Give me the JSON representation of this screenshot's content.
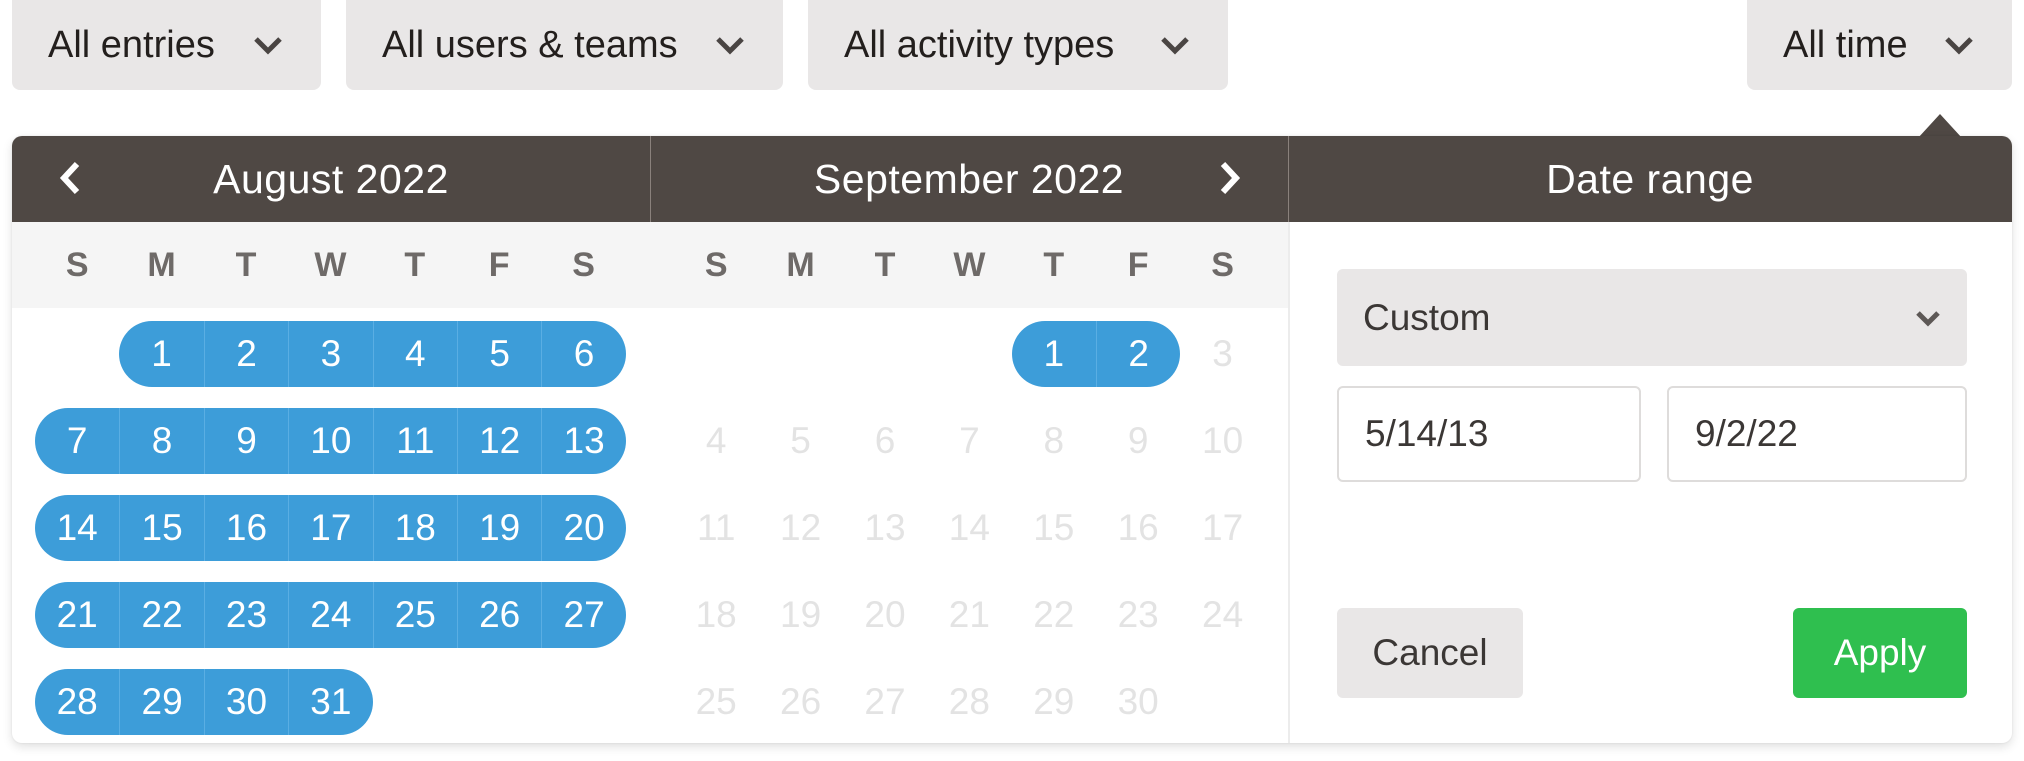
{
  "filters": {
    "entries": "All entries",
    "users": "All users & teams",
    "activity": "All activity types",
    "time": "All time"
  },
  "calendar": {
    "prev_icon": "chevron-left-icon",
    "next_icon": "chevron-right-icon",
    "weekdays": [
      "S",
      "M",
      "T",
      "W",
      "T",
      "F",
      "S"
    ],
    "months": [
      {
        "title": "August 2022",
        "first_weekday": 1,
        "days": 31,
        "selected_from": 1,
        "selected_to": 31,
        "disabled_from": null
      },
      {
        "title": "September 2022",
        "first_weekday": 4,
        "days": 30,
        "selected_from": 1,
        "selected_to": 2,
        "disabled_from": 3
      }
    ]
  },
  "date_range": {
    "title": "Date range",
    "preset": "Custom",
    "from": "5/14/13",
    "to": "9/2/22",
    "cancel_label": "Cancel",
    "apply_label": "Apply"
  },
  "colors": {
    "header": "#4f4844",
    "selected": "#3d9dd9",
    "apply": "#2fbf4f"
  }
}
